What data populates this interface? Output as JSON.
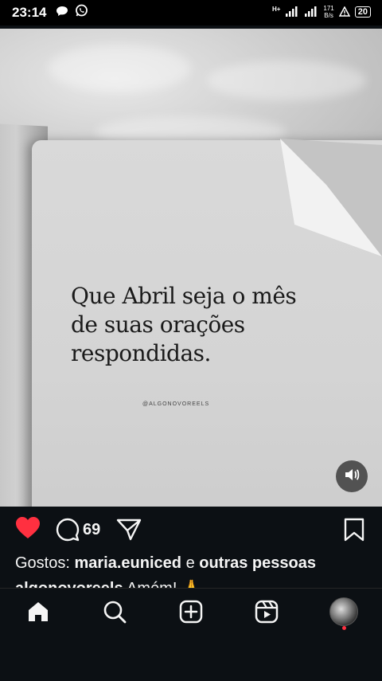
{
  "status_bar": {
    "time": "23:14",
    "network_type": "H+",
    "speed_value": "171",
    "speed_unit": "B/s",
    "battery": "20",
    "icons": [
      "chat-bubble-icon",
      "whatsapp-icon",
      "signal-icon",
      "signal-icon",
      "alert-icon",
      "battery-icon"
    ]
  },
  "post": {
    "quote_text": "Que Abril seja o mês\nde suas orações\nrespondidas.",
    "watermark": "@ALGONOVOREELS",
    "comment_count": "69",
    "likes_prefix": "Gostos:",
    "liked_by_user": "maria.euniced",
    "likes_connector": "e",
    "likes_others": "outras pessoas",
    "caption_user": "algonovoreels",
    "caption_text": "Amém! 🙏"
  },
  "colors": {
    "like_active": "#ff3040",
    "background": "#0c1014",
    "text": "#f5f5f5"
  },
  "navbar": {
    "items": [
      "home-icon",
      "search-icon",
      "create-icon",
      "reels-icon",
      "profile-avatar"
    ]
  }
}
